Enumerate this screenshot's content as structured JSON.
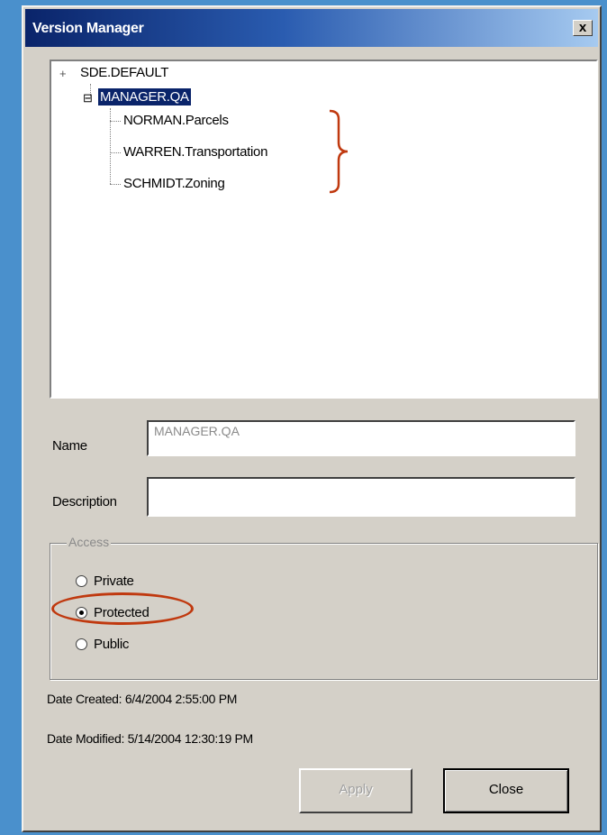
{
  "window": {
    "title": "Version Manager",
    "close_glyph": "x"
  },
  "tree": {
    "root": "SDE.DEFAULT",
    "root_expander": "+",
    "child": "MANAGER.QA",
    "child_expander": "⊟",
    "leaves": [
      "NORMAN.Parcels",
      "WARREN.Transportation",
      "SCHMIDT.Zoning"
    ]
  },
  "form": {
    "name_label": "Name",
    "name_value": "MANAGER.QA",
    "description_label": "Description",
    "description_value": ""
  },
  "access": {
    "legend": "Access",
    "options": [
      "Private",
      "Protected",
      "Public"
    ],
    "selected": "Protected"
  },
  "dates": {
    "created": "Date Created:  6/4/2004 2:55:00 PM",
    "modified": "Date Modified: 5/14/2004 12:30:19 PM"
  },
  "buttons": {
    "apply": "Apply",
    "close": "Close"
  },
  "annotation_color": "#c0390f"
}
